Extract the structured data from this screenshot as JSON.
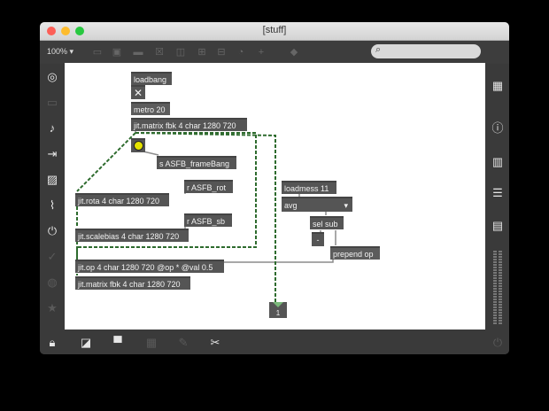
{
  "window": {
    "title": "[stuff]"
  },
  "toolbar": {
    "zoom": "100%",
    "zoom_arrow": "▾"
  },
  "objects": {
    "loadbang": "loadbang",
    "metro": "metro 20",
    "matrix_top": "jit.matrix fbk 4 char 1280 720",
    "send_framebang": "s ASFB_frameBang",
    "recv_rot": "r ASFB_rot",
    "rota": "jit.rota 4 char 1280 720",
    "recv_sb": "r ASFB_sb",
    "scalebias": "jit.scalebias 4 char 1280 720",
    "op": "jit.op 4 char 1280 720 @op * @val 0.5",
    "matrix_bottom": "jit.matrix fbk 4 char 1280 720",
    "loadmess": "loadmess 11",
    "menu_value": "avg",
    "sel": "sel sub",
    "minus": "-",
    "prepend": "prepend op",
    "outlet_number": "1"
  },
  "colors": {
    "patch_bg": "#ffffff",
    "object_bg": "#555555",
    "patch_cord": "#8c8c8c",
    "jitter_cord": "#2e6b2e"
  }
}
